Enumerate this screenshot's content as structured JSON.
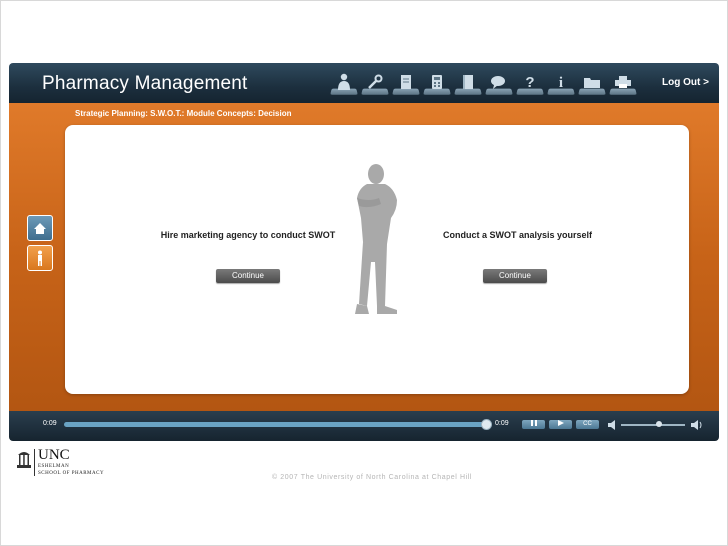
{
  "header": {
    "title": "Pharmacy Management",
    "logout_label": "Log Out >",
    "toolbar_icons": [
      "person-icon",
      "tools-icon",
      "document-icon",
      "calculator-icon",
      "book-icon",
      "chat-icon",
      "help-icon",
      "info-icon",
      "folder-icon",
      "print-icon"
    ]
  },
  "stage": {
    "breadcrumb": "Strategic Planning: S.W.O.T.: Module Concepts: Decision",
    "options": [
      {
        "text": "Hire marketing agency to conduct SWOT",
        "button": "Continue"
      },
      {
        "text": "Conduct a SWOT analysis yourself",
        "button": "Continue"
      }
    ]
  },
  "player": {
    "time_current": "0:09",
    "time_total": "0:09",
    "cc_label": "CC",
    "progress": 1.0,
    "volume": 0.6
  },
  "footer": {
    "logo_main": "UNC",
    "logo_line1": "ESHELMAN",
    "logo_line2": "SCHOOL OF PHARMACY",
    "copyright": "© 2007 The University of North Carolina at Chapel Hill"
  },
  "colors": {
    "header_dark": "#1c2f3e",
    "stage_orange": "#c76318",
    "scrubber_blue": "#6aa3c3"
  }
}
